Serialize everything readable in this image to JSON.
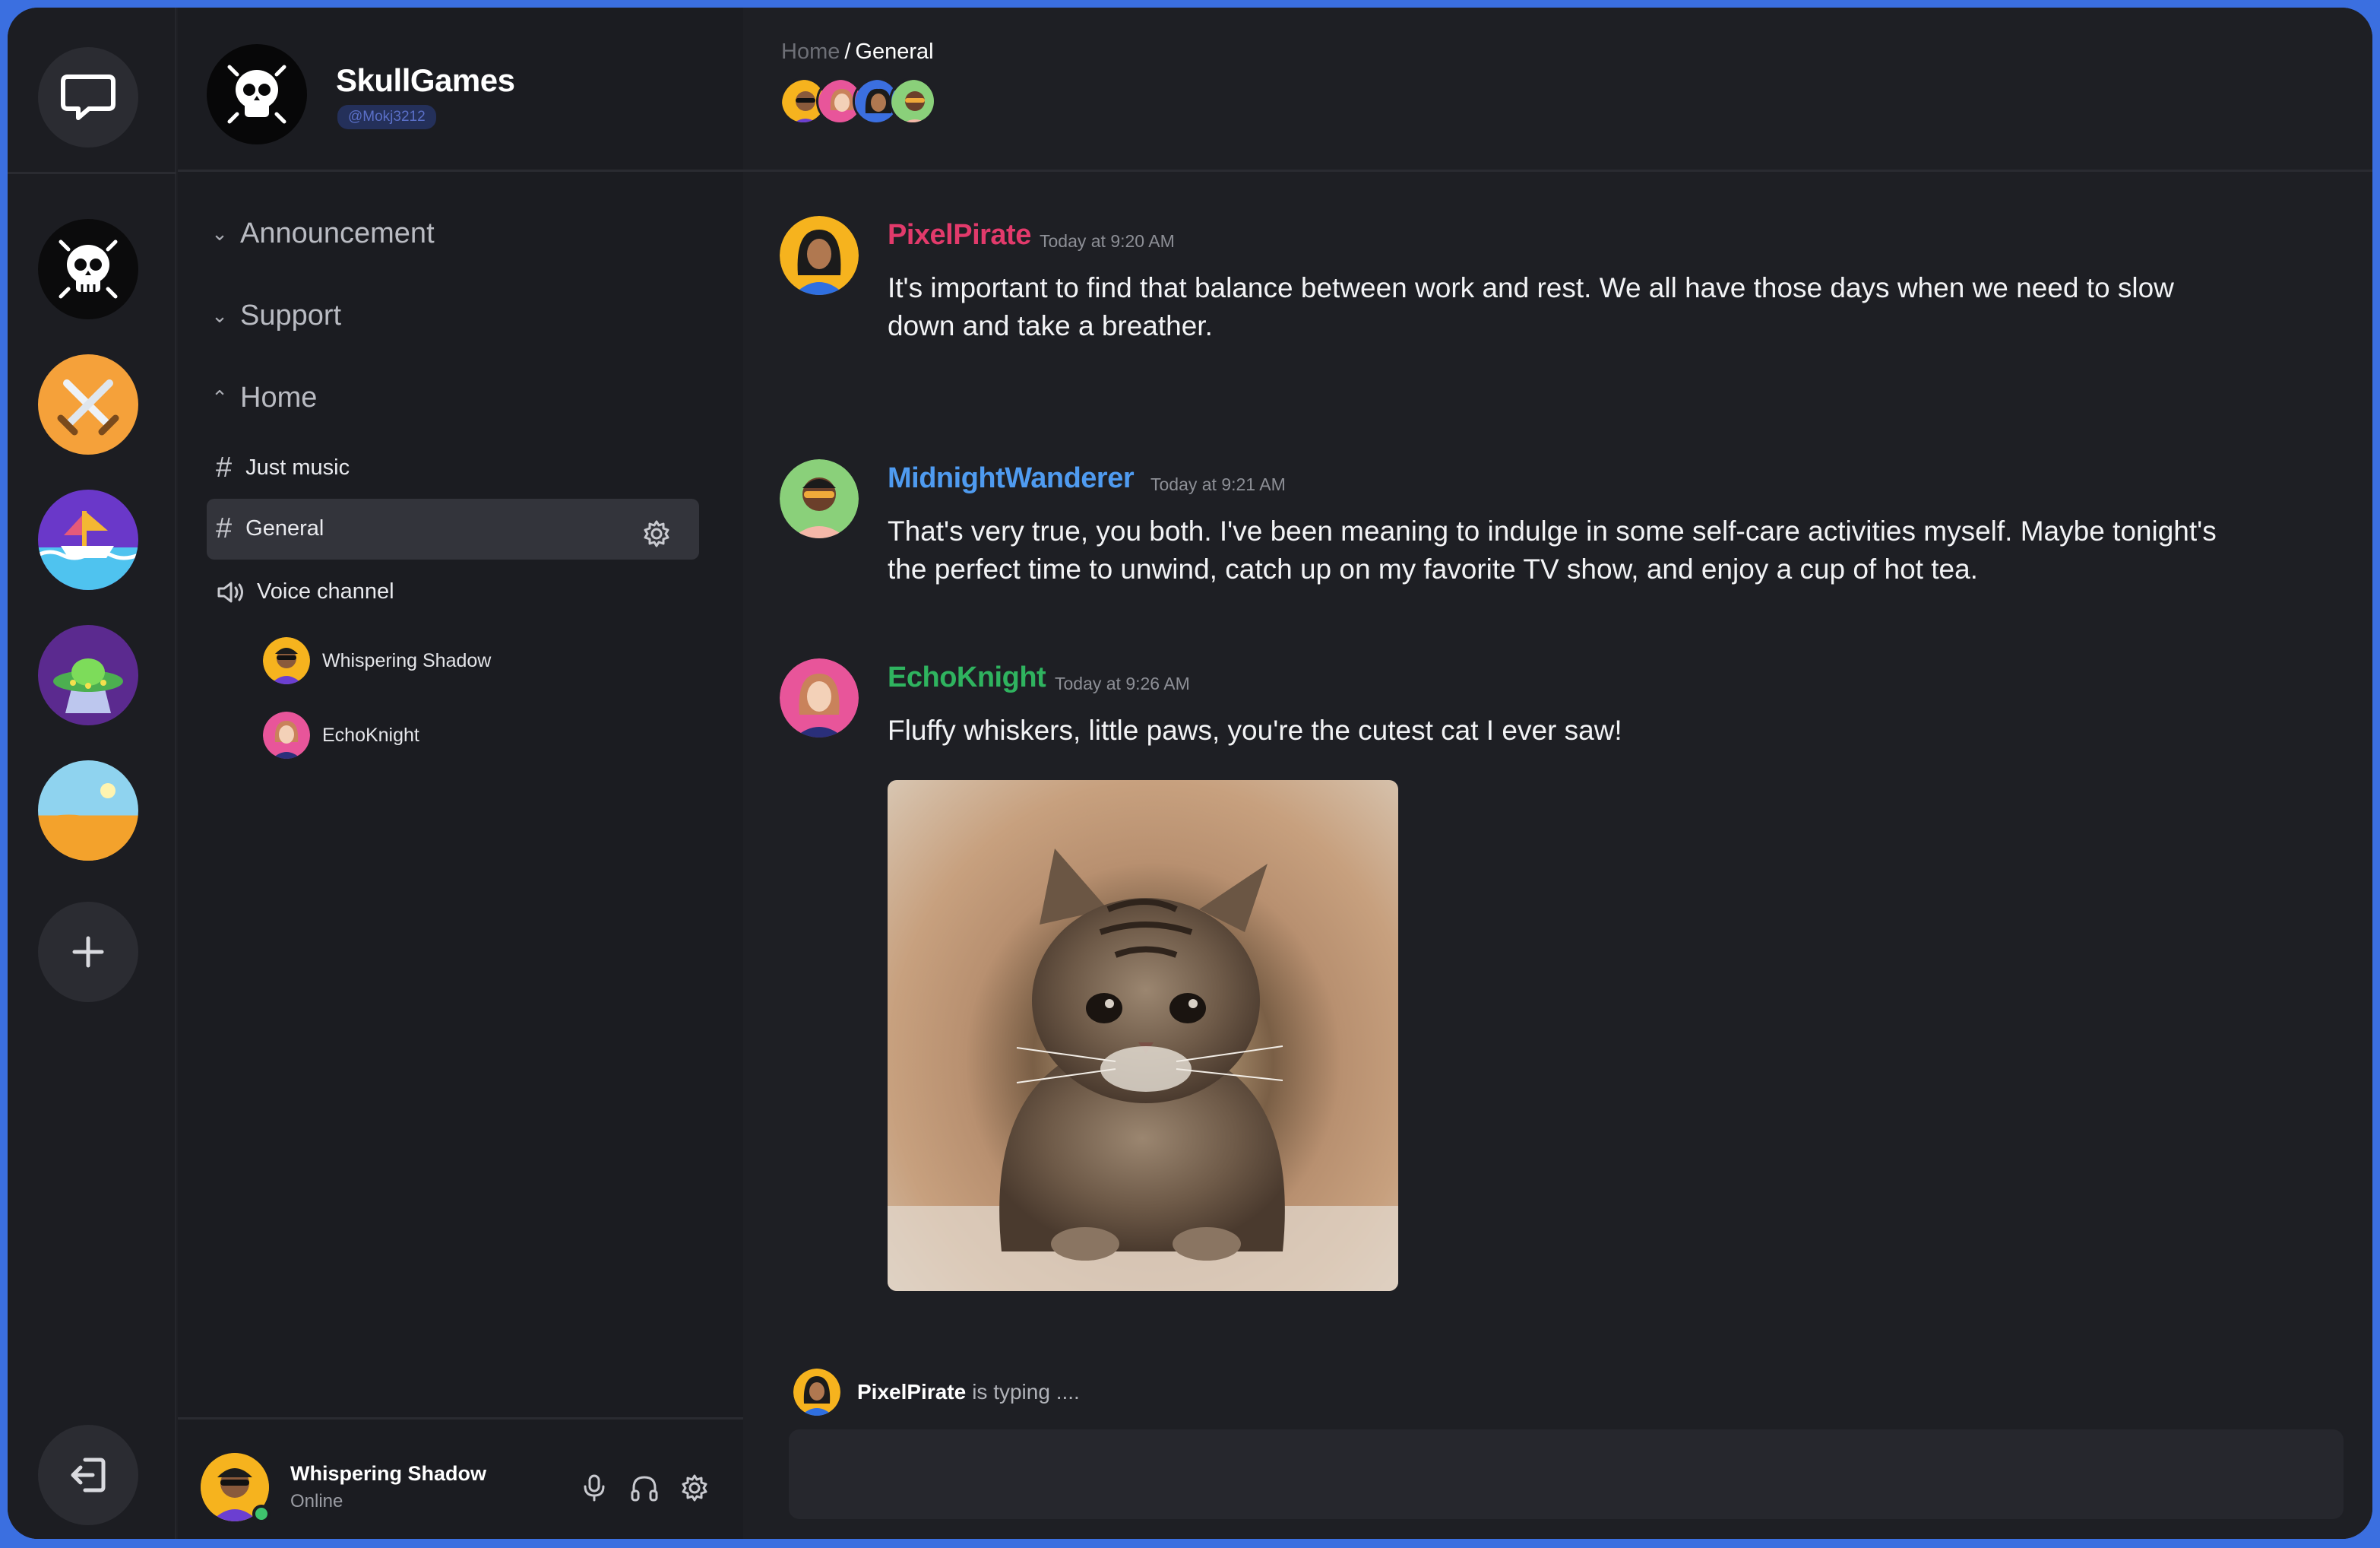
{
  "server": {
    "name": "SkullGames",
    "handle": "@Mokj3212"
  },
  "categories": [
    {
      "label": "Announcement",
      "expanded": false
    },
    {
      "label": "Support",
      "expanded": false
    },
    {
      "label": "Home",
      "expanded": true
    }
  ],
  "channels": [
    {
      "label": "Just music",
      "type": "text",
      "active": false
    },
    {
      "label": "General",
      "type": "text",
      "active": true
    },
    {
      "label": "Voice channel",
      "type": "voice",
      "active": false
    }
  ],
  "voice_users": [
    {
      "name": "Whispering Shadow"
    },
    {
      "name": "EchoKnight"
    }
  ],
  "user": {
    "name": "Whispering Shadow",
    "status": "Online"
  },
  "breadcrumb": {
    "parent": "Home",
    "separator": "/",
    "current": "General"
  },
  "messages": [
    {
      "author": "PixelPirate",
      "time": "Today at 9:20 AM",
      "text": "It's important to find that balance between work and rest. We all have those days when we need to slow down and take a breather.",
      "color": "#e23a6b"
    },
    {
      "author": "MidnightWanderer",
      "time": "Today at 9:21 AM",
      "text": "That's very true, you both. I've been meaning to indulge in some self-care activities myself. Maybe tonight's the perfect time to unwind, catch up on my favorite TV show, and enjoy a cup of hot tea.",
      "color": "#4f9bf0"
    },
    {
      "author": "EchoKnight",
      "time": "Today at 9:26 AM",
      "text": "Fluffy whiskers, little paws, you're the cutest cat I ever saw!",
      "color": "#2fb35f"
    }
  ],
  "typing": {
    "user": "PixelPirate",
    "suffix": "is typing ...."
  },
  "icons": {
    "rail_top": "chat-bubble-icon",
    "rail_add": "plus-icon",
    "rail_exit": "logout-icon",
    "channel_settings": "gear-icon",
    "user_bar": [
      "microphone-icon",
      "headphones-icon",
      "gear-icon"
    ]
  },
  "colors": {
    "accent": "#3b6fe0",
    "online": "#3ec46d"
  }
}
